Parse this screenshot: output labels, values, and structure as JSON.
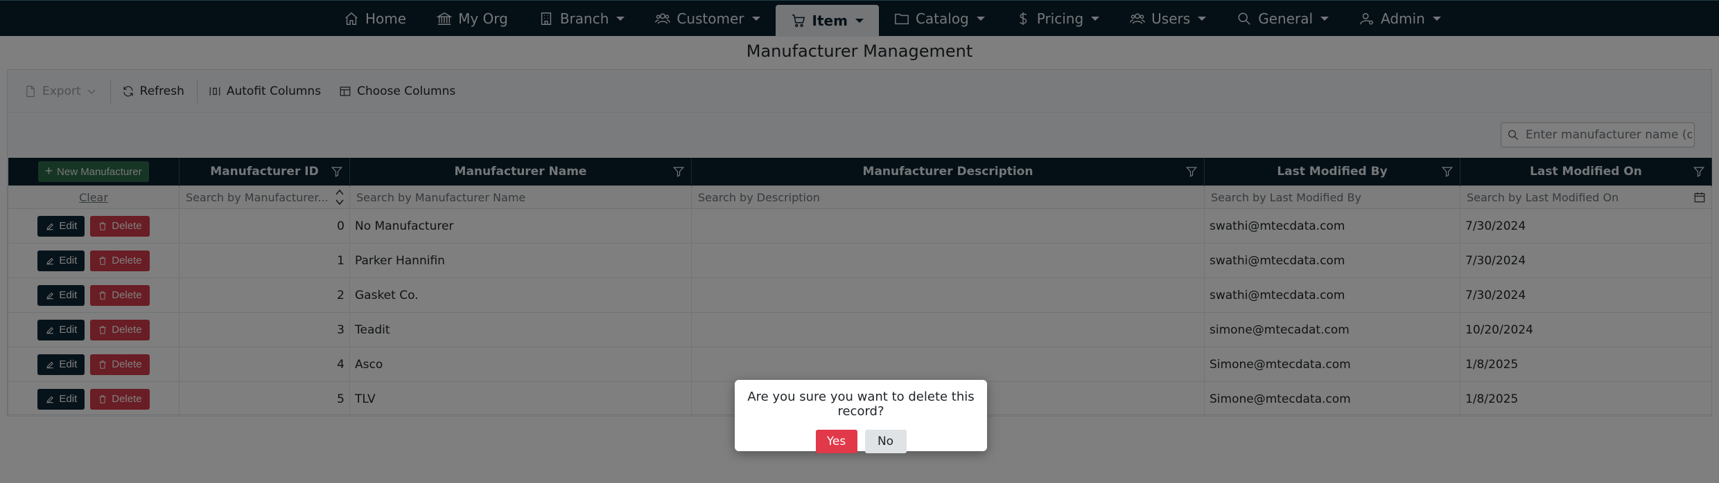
{
  "nav": {
    "items": [
      {
        "label": "Home",
        "icon": "home-icon"
      },
      {
        "label": "My Org",
        "icon": "bank-icon"
      },
      {
        "label": "Branch",
        "icon": "building-icon"
      },
      {
        "label": "Customer",
        "icon": "users-icon"
      },
      {
        "label": "Item",
        "icon": "cart-icon"
      },
      {
        "label": "Catalog",
        "icon": "folder-icon"
      },
      {
        "label": "Pricing",
        "icon": "dollar-icon"
      },
      {
        "label": "Users",
        "icon": "users-icon"
      },
      {
        "label": "General",
        "icon": "search-icon"
      },
      {
        "label": "Admin",
        "icon": "admin-user-icon"
      }
    ],
    "active": "Item"
  },
  "page": {
    "title": "Manufacturer Management"
  },
  "toolbar": {
    "export_label": "Export",
    "refresh_label": "Refresh",
    "autofit_label": "Autofit Columns",
    "choose_label": "Choose Columns"
  },
  "search": {
    "placeholder": "Enter manufacturer name (o..."
  },
  "grid": {
    "new_button": "New Manufacturer",
    "columns": {
      "id": "Manufacturer ID",
      "name": "Manufacturer Name",
      "desc": "Manufacturer Description",
      "modby": "Last Modified By",
      "modon": "Last Modified On"
    },
    "filters": {
      "clear": "Clear",
      "id": "Search by Manufacturer...",
      "name": "Search by Manufacturer Name",
      "desc": "Search by Description",
      "modby": "Search by Last Modified By",
      "modon": "Search by Last Modified On"
    },
    "edit_label": "Edit",
    "delete_label": "Delete",
    "rows": [
      {
        "id": "0",
        "name": "No Manufacturer",
        "desc": "",
        "modby": "swathi@mtecdata.com",
        "modon": "7/30/2024"
      },
      {
        "id": "1",
        "name": "Parker Hannifin",
        "desc": "",
        "modby": "swathi@mtecdata.com",
        "modon": "7/30/2024"
      },
      {
        "id": "2",
        "name": "Gasket Co.",
        "desc": "",
        "modby": "swathi@mtecdata.com",
        "modon": "7/30/2024"
      },
      {
        "id": "3",
        "name": "Teadit",
        "desc": "",
        "modby": "simone@mtecadat.com",
        "modon": "10/20/2024"
      },
      {
        "id": "4",
        "name": "Asco",
        "desc": "",
        "modby": "Simone@mtecdata.com",
        "modon": "1/8/2025"
      },
      {
        "id": "5",
        "name": "TLV",
        "desc": "",
        "modby": "Simone@mtecdata.com",
        "modon": "1/8/2025"
      }
    ]
  },
  "dialog": {
    "message": "Are you sure you want to delete this record?",
    "yes": "Yes",
    "no": "No"
  }
}
